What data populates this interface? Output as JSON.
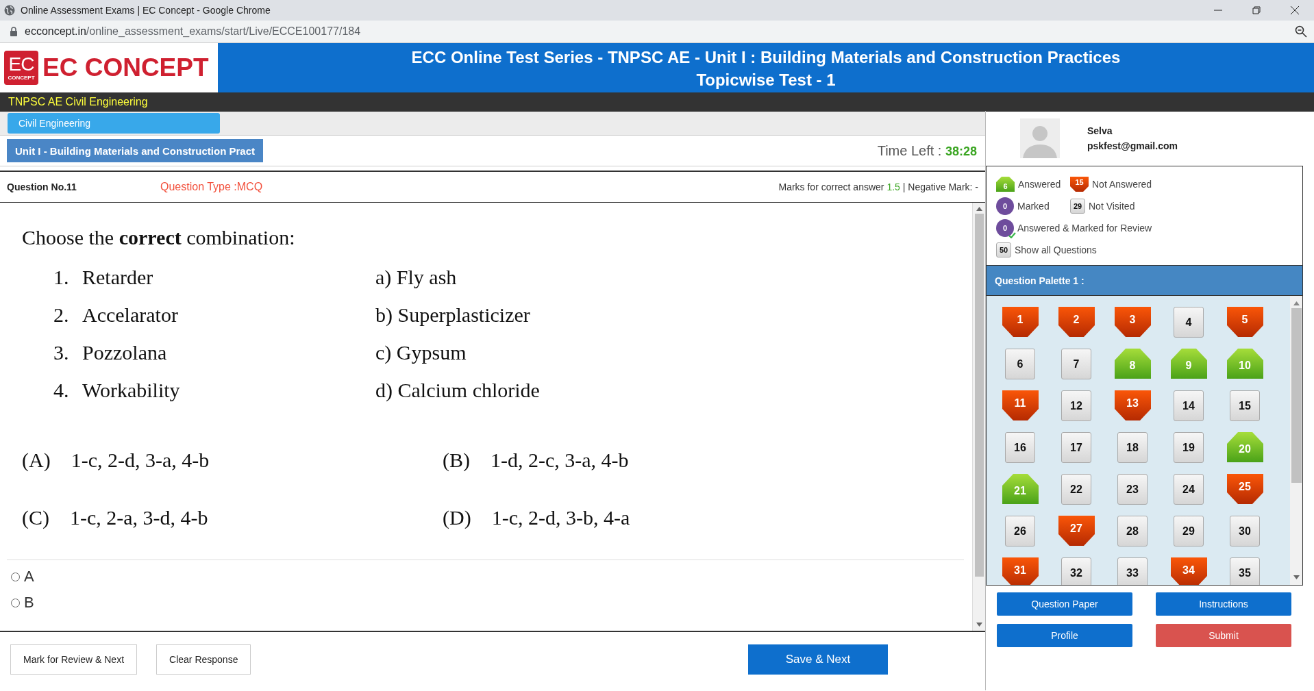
{
  "browser": {
    "title": "Online Assessment Exams | EC Concept - Google Chrome",
    "url_domain": "ecconcept.in",
    "url_path": "/online_assessment_exams/start/Live/ECCE100177/184"
  },
  "logo": {
    "badge_text": "EC",
    "badge_subtext": "CONCEPT",
    "name": "EC CONCEPT"
  },
  "header": {
    "title": "ECC Online Test Series - TNPSC AE - Unit I : Building Materials and Construction Practices",
    "subtitle": "Topicwise Test - 1"
  },
  "course_bar": "TNPSC AE Civil Engineering",
  "subject_tabs": [
    {
      "label": "Civil Engineering",
      "selected": true
    }
  ],
  "section_tabs": [
    {
      "label": "Unit I - Building Materials and Construction Pract",
      "selected": true
    }
  ],
  "timer": {
    "label": "Time Left :",
    "value": "38:28"
  },
  "user": {
    "name": "Selva",
    "email": "pskfest@gmail.com"
  },
  "question": {
    "number": "Question No.11",
    "type": "Question Type :MCQ",
    "marks_label": "Marks for correct answer",
    "marks_value": "1.5",
    "negative": "| Negative Mark: -",
    "stem": "Choose the **correct** combination:",
    "list_left": [
      {
        "num": "1.",
        "text": "Retarder"
      },
      {
        "num": "2.",
        "text": "Accelarator"
      },
      {
        "num": "3.",
        "text": "Pozzolana"
      },
      {
        "num": "4.",
        "text": "Workability"
      }
    ],
    "list_right": [
      "a) Fly ash",
      "b) Superplasticizer",
      "c) Gypsum",
      "d) Calcium chloride"
    ],
    "choices": [
      {
        "label": "(A)",
        "text": "1-c, 2-d, 3-a, 4-b"
      },
      {
        "label": "(B)",
        "text": "1-d, 2-c, 3-a, 4-b"
      },
      {
        "label": "(C)",
        "text": "1-c, 2-a, 3-d, 4-b"
      },
      {
        "label": "(D)",
        "text": "1-c, 2-d, 3-b, 4-a"
      }
    ],
    "options": [
      {
        "label": "A",
        "selected": false
      },
      {
        "label": "B",
        "selected": false
      }
    ]
  },
  "actions": [
    "Mark for Review & Next",
    "Clear Response",
    "Save & Next"
  ],
  "legend": [
    {
      "kind": "answered",
      "count": "6",
      "label": "Answered"
    },
    {
      "kind": "not_answered",
      "count": "15",
      "label": "Not Answered"
    },
    {
      "kind": "marked",
      "count": "0",
      "label": "Marked"
    },
    {
      "kind": "not_visited",
      "count": "29",
      "label": "Not Visited"
    },
    {
      "kind": "answered_marked",
      "count": "0",
      "label": "Answered & Marked for Review"
    },
    {
      "kind": "all",
      "count": "50",
      "label": "Show all Questions"
    }
  ],
  "palette": {
    "title": "Question Palette 1 :",
    "questions": [
      {
        "n": "1",
        "kind": "not_answered"
      },
      {
        "n": "2",
        "kind": "not_answered"
      },
      {
        "n": "3",
        "kind": "not_answered"
      },
      {
        "n": "4",
        "kind": "not_visited"
      },
      {
        "n": "5",
        "kind": "not_answered"
      },
      {
        "n": "6",
        "kind": "not_visited"
      },
      {
        "n": "7",
        "kind": "not_visited"
      },
      {
        "n": "8",
        "kind": "answered"
      },
      {
        "n": "9",
        "kind": "answered"
      },
      {
        "n": "10",
        "kind": "answered"
      },
      {
        "n": "11",
        "kind": "not_answered"
      },
      {
        "n": "12",
        "kind": "not_visited"
      },
      {
        "n": "13",
        "kind": "not_answered"
      },
      {
        "n": "14",
        "kind": "not_visited"
      },
      {
        "n": "15",
        "kind": "not_visited"
      },
      {
        "n": "16",
        "kind": "not_visited"
      },
      {
        "n": "17",
        "kind": "not_visited"
      },
      {
        "n": "18",
        "kind": "not_visited"
      },
      {
        "n": "19",
        "kind": "not_visited"
      },
      {
        "n": "20",
        "kind": "answered"
      },
      {
        "n": "21",
        "kind": "answered"
      },
      {
        "n": "22",
        "kind": "not_visited"
      },
      {
        "n": "23",
        "kind": "not_visited"
      },
      {
        "n": "24",
        "kind": "not_visited"
      },
      {
        "n": "25",
        "kind": "not_answered"
      },
      {
        "n": "26",
        "kind": "not_visited"
      },
      {
        "n": "27",
        "kind": "not_answered"
      },
      {
        "n": "28",
        "kind": "not_visited"
      },
      {
        "n": "29",
        "kind": "not_visited"
      },
      {
        "n": "30",
        "kind": "not_visited"
      },
      {
        "n": "31",
        "kind": "not_answered"
      },
      {
        "n": "32",
        "kind": "not_visited"
      },
      {
        "n": "33",
        "kind": "not_visited"
      },
      {
        "n": "34",
        "kind": "not_answered"
      },
      {
        "n": "35",
        "kind": "not_visited"
      }
    ]
  },
  "side_buttons": [
    {
      "kind": "primary",
      "label": "Question Paper"
    },
    {
      "kind": "primary",
      "label": "Instructions"
    },
    {
      "kind": "primary",
      "label": "Profile"
    },
    {
      "kind": "danger",
      "label": "Submit"
    }
  ]
}
